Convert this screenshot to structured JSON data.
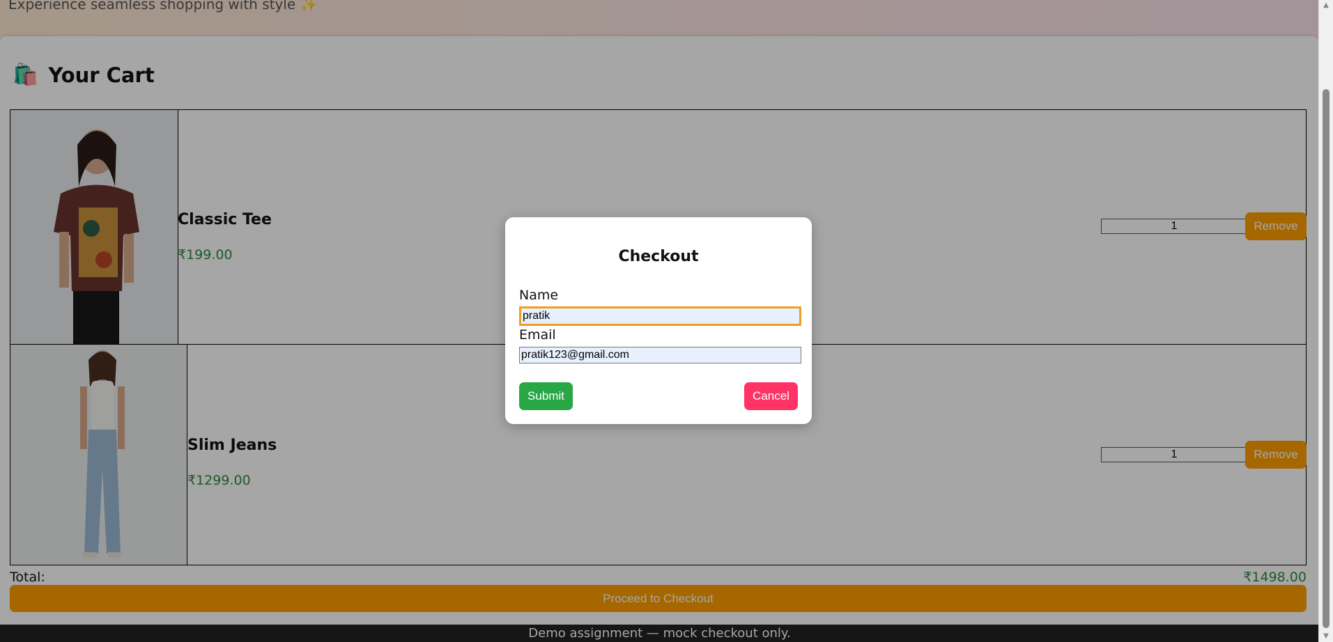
{
  "header": {
    "tagline": "Experience seamless shopping with style ✨"
  },
  "cart": {
    "title": "Your Cart",
    "items": [
      {
        "name": "Classic Tee",
        "price": "₹199.00",
        "quantity": "1",
        "remove_label": "Remove"
      },
      {
        "name": "Slim Jeans",
        "price": "₹1299.00",
        "quantity": "1",
        "remove_label": "Remove"
      }
    ],
    "total_label": "Total:",
    "total_value": "₹1498.00",
    "checkout_label": "Proceed to Checkout"
  },
  "footer": {
    "text": "Demo assignment — mock checkout only."
  },
  "modal": {
    "title": "Checkout",
    "name_label": "Name",
    "name_value": "pratik",
    "email_label": "Email",
    "email_value": "pratik123@gmail.com",
    "submit_label": "Submit",
    "cancel_label": "Cancel"
  },
  "colors": {
    "accent": "#ff9f00",
    "price": "#2e8b3d",
    "submit": "#28a745",
    "cancel": "#ff3366"
  },
  "icons": {
    "bag": "shopping-bags-icon"
  }
}
